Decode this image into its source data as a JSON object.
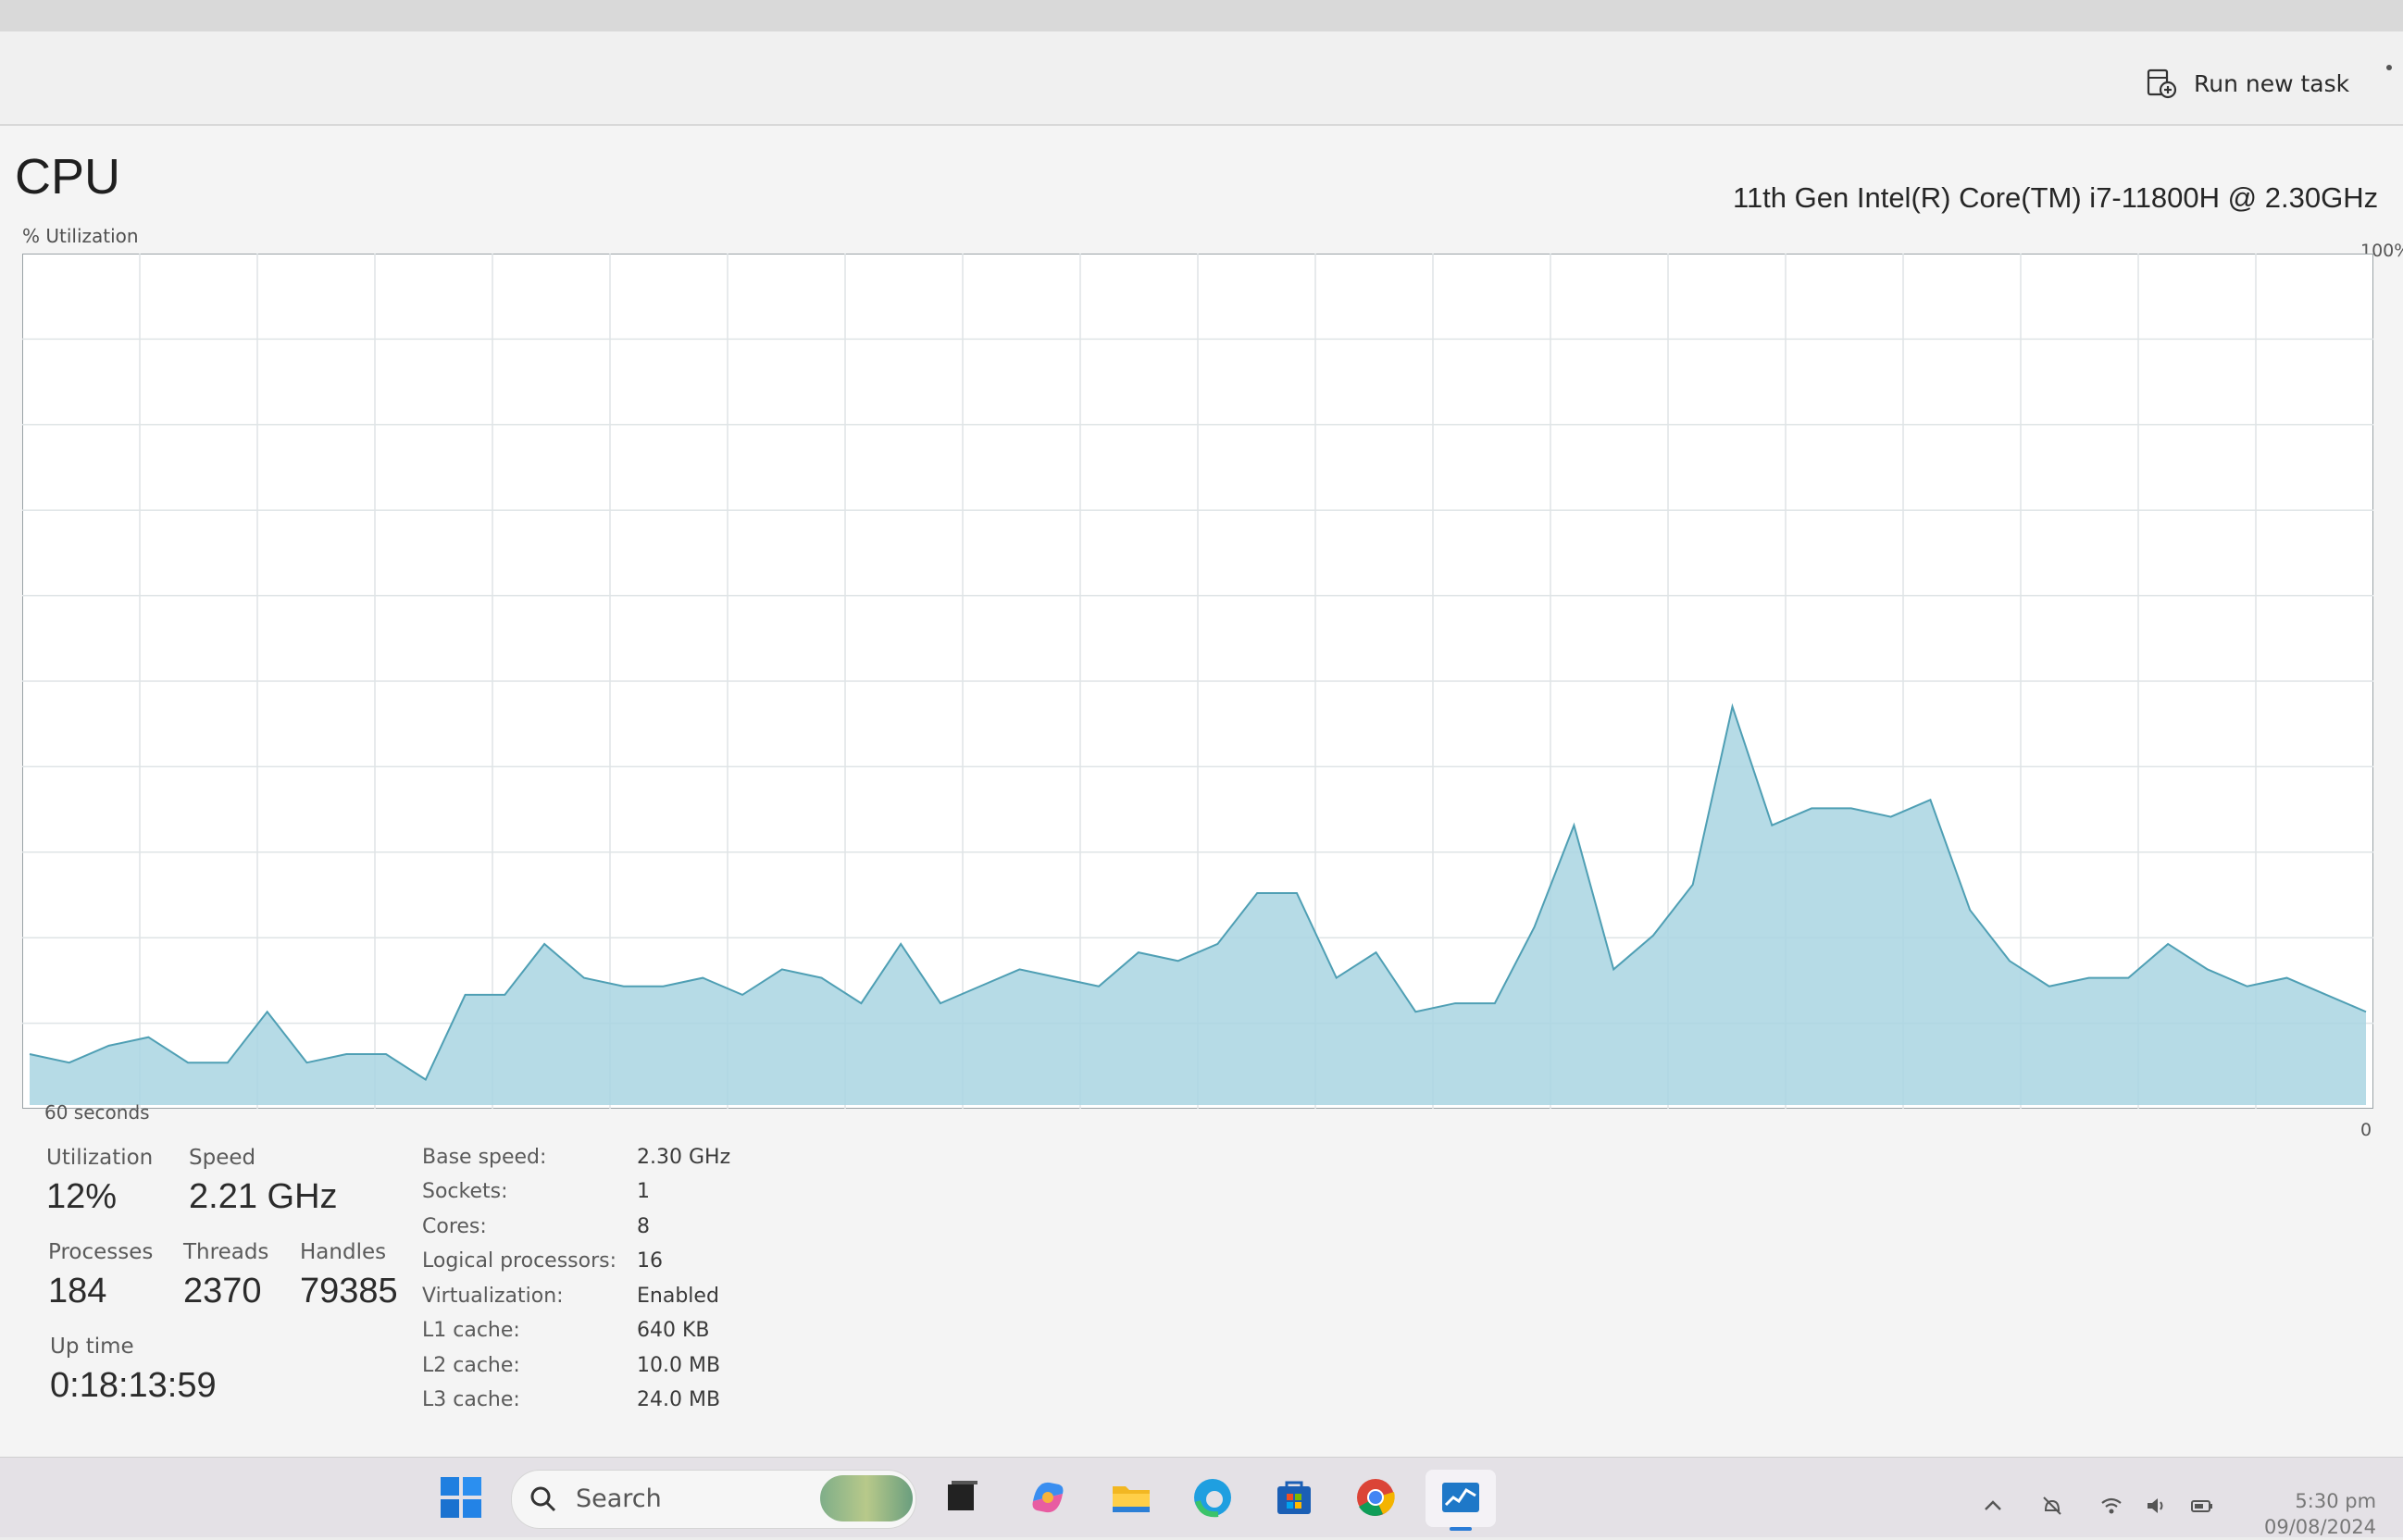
{
  "toolbar": {
    "run_new_task_label": "Run new task"
  },
  "header": {
    "title": "CPU",
    "cpu_model": "11th Gen Intel(R) Core(TM) i7-11800H @ 2.30GHz"
  },
  "chart": {
    "y_label": "% Utilization",
    "y_max_label": "100%",
    "x_label": "60 seconds",
    "y_min_label": "0"
  },
  "chart_data": {
    "type": "area",
    "title": "",
    "xlabel": "60 seconds",
    "ylabel": "% Utilization",
    "ylim": [
      0,
      100
    ],
    "grid": true,
    "x": [
      0,
      1,
      2,
      3,
      4,
      5,
      6,
      7,
      8,
      9,
      10,
      11,
      12,
      13,
      14,
      15,
      16,
      17,
      18,
      19,
      20,
      21,
      22,
      23,
      24,
      25,
      26,
      27,
      28,
      29,
      30,
      31,
      32,
      33,
      34,
      35,
      36,
      37,
      38,
      39,
      40,
      41,
      42,
      43,
      44,
      45,
      46,
      47,
      48,
      49,
      50,
      51,
      52,
      53,
      54,
      55,
      56,
      57,
      58,
      59,
      60
    ],
    "series": [
      {
        "color": "#a9d5e2",
        "values": [
          6,
          5,
          7,
          8,
          5,
          5,
          11,
          5,
          6,
          6,
          3,
          13,
          13,
          19,
          15,
          14,
          14,
          15,
          13,
          16,
          15,
          12,
          19,
          12,
          14,
          16,
          15,
          14,
          18,
          17,
          19,
          25,
          25,
          15,
          18,
          11,
          12,
          12,
          21,
          33,
          16,
          20,
          26,
          47,
          33,
          35,
          35,
          34,
          36,
          23,
          17,
          14,
          15,
          15,
          19,
          16,
          14,
          15,
          13,
          11
        ]
      }
    ]
  },
  "stats": {
    "utilization_label": "Utilization",
    "utilization_value": "12%",
    "speed_label": "Speed",
    "speed_value": "2.21 GHz",
    "processes_label": "Processes",
    "processes_value": "184",
    "threads_label": "Threads",
    "threads_value": "2370",
    "handles_label": "Handles",
    "handles_value": "79385",
    "uptime_label": "Up time",
    "uptime_value": "0:18:13:59"
  },
  "details": [
    {
      "key": "Base speed:",
      "value": "2.30 GHz"
    },
    {
      "key": "Sockets:",
      "value": "1"
    },
    {
      "key": "Cores:",
      "value": "8"
    },
    {
      "key": "Logical processors:",
      "value": "16"
    },
    {
      "key": "Virtualization:",
      "value": "Enabled"
    },
    {
      "key": "L1 cache:",
      "value": "640 KB"
    },
    {
      "key": "L2 cache:",
      "value": "10.0 MB"
    },
    {
      "key": "L3 cache:",
      "value": "24.0 MB"
    }
  ],
  "taskbar": {
    "search_placeholder": "Search",
    "apps": [
      "start-icon",
      "task-view-icon",
      "copilot-icon",
      "file-explorer-icon",
      "edge-icon",
      "store-icon",
      "chrome-icon",
      "task-manager-icon"
    ],
    "time": "5:30 pm",
    "date": "09/08/2024"
  }
}
